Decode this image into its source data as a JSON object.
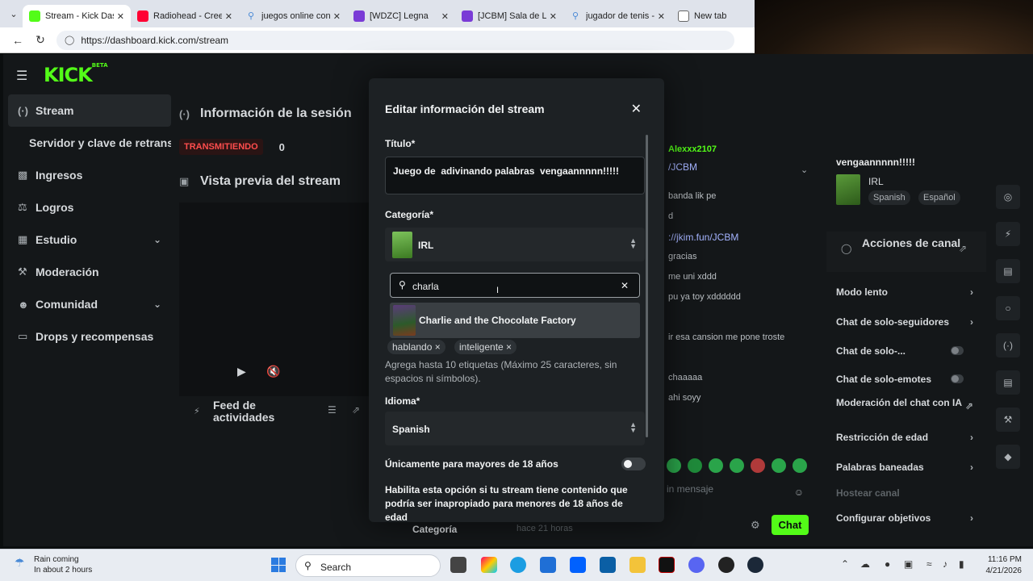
{
  "browser": {
    "tabs": [
      {
        "label": "Stream - Kick Dashb",
        "active": true,
        "color": "#53fc18"
      },
      {
        "label": "Radiohead - Creep",
        "active": false,
        "color": "#ff0033"
      },
      {
        "label": "juegos online con a",
        "active": false,
        "color": "#4a8ad6"
      },
      {
        "label": "[WDZC] Legna",
        "active": false,
        "color": "#7a3bd6"
      },
      {
        "label": "[JCBM] Sala de Leg",
        "active": false,
        "color": "#7a3bd6"
      },
      {
        "label": "jugador de tenis - S",
        "active": false,
        "color": "#4a8ad6"
      },
      {
        "label": "New tab",
        "active": false,
        "color": "#666666"
      }
    ],
    "url": "https://dashboard.kick.com/stream"
  },
  "app": {
    "logo": "KICK",
    "logo_beta": "BETA"
  },
  "sidebar": {
    "items": [
      {
        "label": "Stream",
        "icon": "broadcast-icon",
        "active": true
      },
      {
        "label": "Servidor y clave de retransm",
        "sub": true
      },
      {
        "label": "Ingresos",
        "icon": "money-icon"
      },
      {
        "label": "Logros",
        "icon": "trophy-icon"
      },
      {
        "label": "Estudio",
        "icon": "studio-icon",
        "expandable": true
      },
      {
        "label": "Moderación",
        "icon": "wrench-icon"
      },
      {
        "label": "Comunidad",
        "icon": "people-icon",
        "expandable": true
      },
      {
        "label": "Drops y recompensas",
        "icon": "gift-icon"
      }
    ]
  },
  "session": {
    "title": "Información de la sesión",
    "live_badge": "TRANSMITIENDO",
    "viewers": "0",
    "preview_title": "Vista previa del stream",
    "feed_title": "Feed de actividades",
    "category_label": "Categoría",
    "category_ago": "hace 21 horas"
  },
  "chat": {
    "username": "Alexxx2107",
    "messages": [
      {
        "text": "/JCBM",
        "type": "link"
      },
      {
        "text": "banda lik pe",
        "type": "msg"
      },
      {
        "text": "d",
        "type": "msg"
      },
      {
        "text": "://jkim.fun/JCBM",
        "type": "link"
      },
      {
        "text": "gracias",
        "type": "msg"
      },
      {
        "text": "me uni xddd",
        "type": "msg"
      },
      {
        "text": "pu ya toy xdddddd",
        "type": "msg"
      },
      {
        "text": "ir esa cansion me pone troste",
        "type": "msg"
      },
      {
        "text": "chaaaaa",
        "type": "msg"
      },
      {
        "text": "ahi soyy",
        "type": "msg"
      }
    ],
    "input_placeholder": "in mensaje",
    "send_label": "Chat"
  },
  "stream_info": {
    "title_short": "vengaannnnn!!!!!",
    "category": "IRL",
    "tags": [
      "Spanish",
      "Español"
    ]
  },
  "channel_actions": {
    "title": "Acciones de canal",
    "items": [
      {
        "label": "Modo lento",
        "control": "chevron"
      },
      {
        "label": "Chat de solo-seguidores",
        "control": "chevron"
      },
      {
        "label": "Chat de solo-...",
        "control": "toggle"
      },
      {
        "label": "Chat de solo-emotes",
        "control": "toggle"
      },
      {
        "label": "Moderación del chat con IA",
        "control": "external"
      },
      {
        "label": "Restricción de edad",
        "control": "chevron"
      },
      {
        "label": "Palabras baneadas",
        "control": "chevron"
      },
      {
        "label": "Hostear canal",
        "control": "none",
        "disabled": true
      },
      {
        "label": "Configurar objetivos",
        "control": "chevron"
      }
    ]
  },
  "modal": {
    "title": "Editar información del stream",
    "title_label": "Título*",
    "title_value": "Juego de  adivinando palabras  vengaannnnn!!!!!",
    "category_label": "Categoría*",
    "category_value": "IRL",
    "search_value": "charla",
    "search_result": "Charlie and the Chocolate Factory",
    "tags": [
      "hablando ×",
      "inteligente ×"
    ],
    "tags_hint": "Agrega hasta 10 etiquetas (Máximo 25 caracteres, sin espacios ni símbolos).",
    "language_label": "Idioma*",
    "language_value": "Spanish",
    "adult_label": "Únicamente para mayores de 18 años",
    "adult_enabled": false,
    "adult_desc": "Habilita esta opción si tu stream tiene contenido que podría ser inapropiado para menores de 18 años de edad"
  },
  "taskbar": {
    "weather_title": "Rain coming",
    "weather_sub": "In about 2 hours",
    "search_label": "Search",
    "time": "11:16 PM",
    "date": "4/21/2026"
  }
}
